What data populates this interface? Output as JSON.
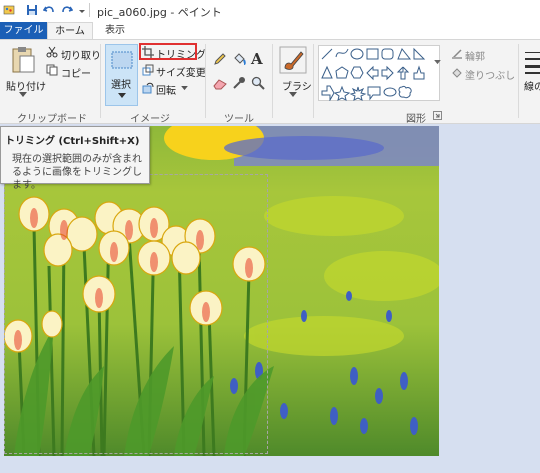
{
  "window": {
    "title": "pic_a060.jpg - ペイント"
  },
  "tabs": {
    "file": "ファイル",
    "home": "ホーム",
    "view": "表示"
  },
  "ribbon": {
    "clipboard": {
      "paste": "貼り付け",
      "cut": "切り取り",
      "copy": "コピー",
      "group": "クリップボード"
    },
    "image": {
      "select": "選択",
      "crop": "トリミング",
      "resize": "サイズ変更",
      "rotate": "回転",
      "group": "イメージ"
    },
    "tools": {
      "group": "ツール"
    },
    "brushes": {
      "label": "ブラシ"
    },
    "shapes": {
      "group": "図形",
      "outline": "輪郭",
      "fill": "塗りつぶし"
    },
    "size": {
      "label": "線の"
    }
  },
  "tooltip": {
    "title": "トリミング (Ctrl+Shift+X)",
    "description": "現在の選択範囲のみが含まれるように画像をトリミングします。"
  },
  "colors": {
    "accent": "#1b5fb6",
    "highlight": "#e03030",
    "selected_bg": "#cce4f7"
  }
}
